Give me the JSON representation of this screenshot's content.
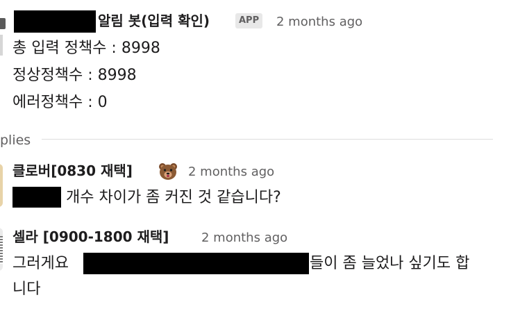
{
  "parent": {
    "sender": "알림 봇(입력 확인)",
    "app_badge": "APP",
    "timestamp": "2 months ago",
    "lines": [
      "총 입력 정책수 : 8998",
      "정상정책수 : 8998",
      "에러정책수 : 0"
    ]
  },
  "replies_label": "plies",
  "replies": [
    {
      "sender": "클로버[0830 재택]",
      "status_icon": "bear-emoji-icon",
      "timestamp": "2 months ago",
      "text": "개수 차이가 좀 커진 것 같습니다?"
    },
    {
      "sender": "셀라 [0900-1800 재택]",
      "timestamp": "2 months ago",
      "text_before": "그러게요",
      "text_after": "들이 좀 늘었나 싶기도 합",
      "text_line2": "니다"
    }
  ]
}
